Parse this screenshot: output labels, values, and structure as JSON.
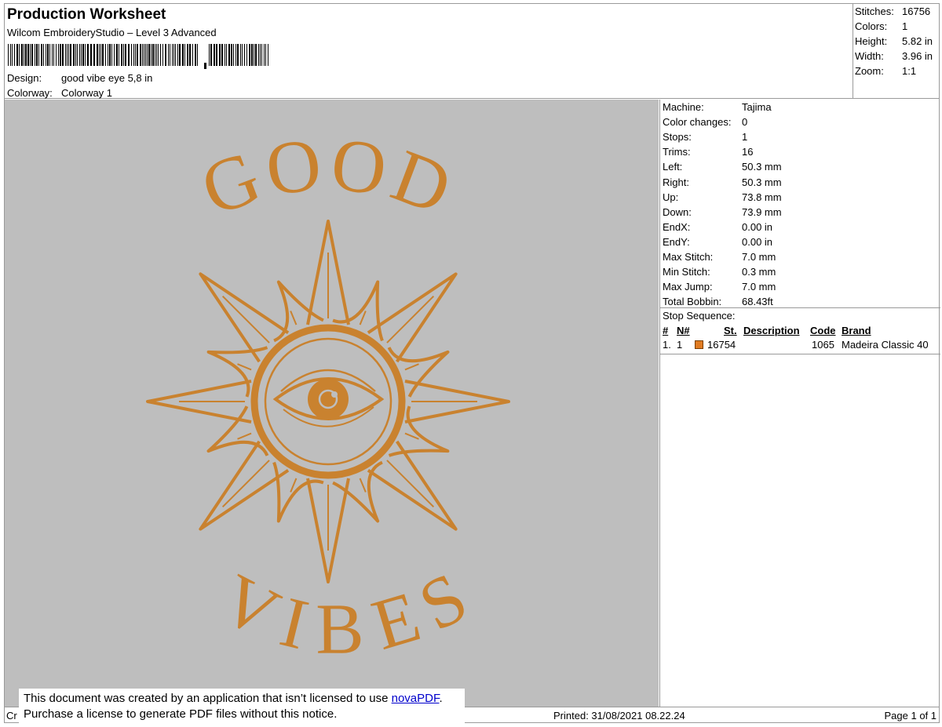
{
  "header": {
    "title": "Production Worksheet",
    "subtitle": "Wilcom EmbroideryStudio – Level 3 Advanced",
    "design_label": "Design:",
    "design_value": "good vibe eye 5,8 in",
    "colorway_label": "Colorway:",
    "colorway_value": "Colorway 1"
  },
  "stats": {
    "stitches_label": "Stitches:",
    "stitches_value": "16756",
    "colors_label": "Colors:",
    "colors_value": "1",
    "height_label": "Height:",
    "height_value": "5.82 in",
    "width_label": "Width:",
    "width_value": "3.96 in",
    "zoom_label": "Zoom:",
    "zoom_value": "1:1"
  },
  "design": {
    "text_top": "GOOD",
    "text_bottom": "VIBES",
    "thread_color": "#c9822f",
    "background_color": "#bebebe"
  },
  "info": [
    {
      "label": "Machine:",
      "value": "Tajima"
    },
    {
      "label": "Color changes:",
      "value": "0"
    },
    {
      "label": "Stops:",
      "value": "1"
    },
    {
      "label": "Trims:",
      "value": "16"
    },
    {
      "label": "Left:",
      "value": "50.3 mm"
    },
    {
      "label": "Right:",
      "value": "50.3 mm"
    },
    {
      "label": "Up:",
      "value": "73.8 mm"
    },
    {
      "label": "Down:",
      "value": "73.9 mm"
    },
    {
      "label": "EndX:",
      "value": "0.00 in"
    },
    {
      "label": "EndY:",
      "value": "0.00 in"
    },
    {
      "label": "Max Stitch:",
      "value": "7.0 mm"
    },
    {
      "label": "Min Stitch:",
      "value": "0.3 mm"
    },
    {
      "label": "Max Jump:",
      "value": "7.0 mm"
    },
    {
      "label": "Total Bobbin:",
      "value": "68.43ft"
    }
  ],
  "stop_sequence": {
    "title": "Stop Sequence:",
    "headers": {
      "num": "#",
      "needle": "N#",
      "stitches": "St.",
      "description": "Description",
      "code": "Code",
      "brand": "Brand"
    },
    "rows": [
      {
        "num": "1.",
        "needle": "1",
        "swatch_color": "#e07b22",
        "stitches": "16754",
        "description": "",
        "code": "1065",
        "brand": "Madeira Classic 40"
      }
    ]
  },
  "footer": {
    "created": "Cr",
    "printed": "Printed: 31/08/2021 08.22.24",
    "page": "Page 1 of 1"
  },
  "notice": {
    "line1_prefix": "This document was created by an application that isn’t licensed to use ",
    "link_text": "novaPDF",
    "line1_suffix": ".",
    "line2": "Purchase a license to generate PDF files without this notice."
  }
}
